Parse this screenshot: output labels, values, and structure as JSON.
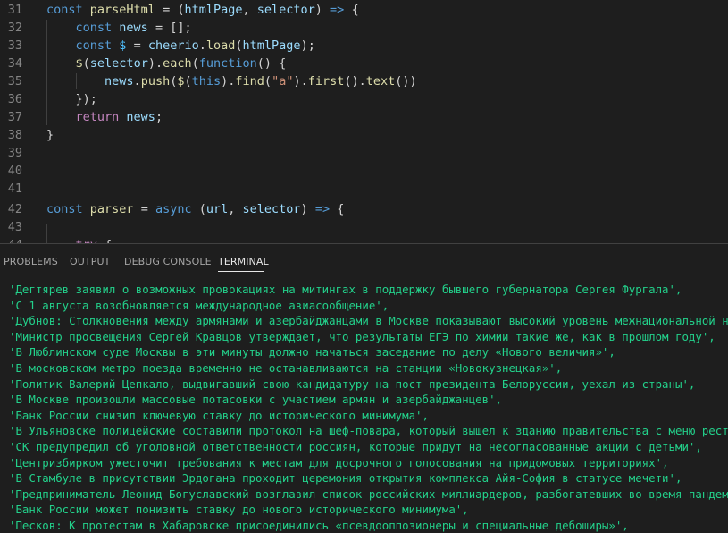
{
  "editor": {
    "lines": [
      {
        "n": "31",
        "tokens": [
          [
            "kw",
            "const "
          ],
          [
            "fn",
            "parseHtml"
          ],
          [
            "pn",
            " = ("
          ],
          [
            "var",
            "htmlPage"
          ],
          [
            "pn",
            ", "
          ],
          [
            "var",
            "selector"
          ],
          [
            "pn",
            ") "
          ],
          [
            "kw",
            "=>"
          ],
          [
            "pn",
            " {"
          ]
        ]
      },
      {
        "n": "32",
        "tokens": [
          [
            "pn",
            "    "
          ],
          [
            "kw",
            "const "
          ],
          [
            "var",
            "news"
          ],
          [
            "pn",
            " = [];"
          ]
        ]
      },
      {
        "n": "33",
        "tokens": [
          [
            "pn",
            "    "
          ],
          [
            "kw",
            "const "
          ],
          [
            "cst",
            "$"
          ],
          [
            "pn",
            " = "
          ],
          [
            "var",
            "cheerio"
          ],
          [
            "pn",
            "."
          ],
          [
            "fn",
            "load"
          ],
          [
            "pn",
            "("
          ],
          [
            "var",
            "htmlPage"
          ],
          [
            "pn",
            ");"
          ]
        ]
      },
      {
        "n": "34",
        "tokens": [
          [
            "pn",
            "    "
          ],
          [
            "fn",
            "$"
          ],
          [
            "pn",
            "("
          ],
          [
            "var",
            "selector"
          ],
          [
            "pn",
            ")."
          ],
          [
            "fn",
            "each"
          ],
          [
            "pn",
            "("
          ],
          [
            "kw",
            "function"
          ],
          [
            "pn",
            "() {"
          ]
        ]
      },
      {
        "n": "35",
        "tokens": [
          [
            "pn",
            "        "
          ],
          [
            "var",
            "news"
          ],
          [
            "pn",
            "."
          ],
          [
            "fn",
            "push"
          ],
          [
            "pn",
            "("
          ],
          [
            "fn",
            "$"
          ],
          [
            "pn",
            "("
          ],
          [
            "kw",
            "this"
          ],
          [
            "pn",
            ")."
          ],
          [
            "fn",
            "find"
          ],
          [
            "pn",
            "("
          ],
          [
            "str",
            "\"a\""
          ],
          [
            "pn",
            ")."
          ],
          [
            "fn",
            "first"
          ],
          [
            "pn",
            "()."
          ],
          [
            "fn",
            "text"
          ],
          [
            "pn",
            "())"
          ]
        ]
      },
      {
        "n": "36",
        "tokens": [
          [
            "pn",
            "    });"
          ]
        ]
      },
      {
        "n": "37",
        "tokens": [
          [
            "pn",
            "    "
          ],
          [
            "kw2",
            "return "
          ],
          [
            "var",
            "news"
          ],
          [
            "pn",
            ";"
          ]
        ]
      },
      {
        "n": "38",
        "tokens": [
          [
            "pn",
            "}"
          ]
        ]
      },
      {
        "n": "39",
        "tokens": []
      },
      {
        "n": "40",
        "tokens": []
      },
      {
        "n": "41",
        "tokens": []
      },
      {
        "n": "42",
        "tokens": [
          [
            "kw",
            "const "
          ],
          [
            "fn",
            "parser"
          ],
          [
            "pn",
            " = "
          ],
          [
            "kw",
            "async"
          ],
          [
            "pn",
            " ("
          ],
          [
            "var",
            "url"
          ],
          [
            "pn",
            ", "
          ],
          [
            "var",
            "selector"
          ],
          [
            "pn",
            ") "
          ],
          [
            "kw",
            "=>"
          ],
          [
            "pn",
            " {"
          ]
        ]
      },
      {
        "n": "43",
        "tokens": []
      },
      {
        "n": "44",
        "tokens": [
          [
            "pn",
            "    "
          ],
          [
            "kw2",
            "try"
          ],
          [
            "pn",
            " {"
          ]
        ]
      }
    ]
  },
  "panel": {
    "tabs": [
      {
        "label": "PROBLEMS",
        "active": false
      },
      {
        "label": "OUTPUT",
        "active": false
      },
      {
        "label": "DEBUG CONSOLE",
        "active": false
      },
      {
        "label": "TERMINAL",
        "active": true
      }
    ]
  },
  "terminal": {
    "lines": [
      "'Дегтярев заявил о возможных провокациях на митингах в поддержку бывшего губернатора Сергея Фургала',",
      "'С 1 августа возобновляется международное авиасообщение',",
      "'Дубнов: Столкновения между армянами и азербайджанцами в Москве показывают высокий уровень межнациональной ненавис",
      "'Министр просвещения Сергей Кравцов утверждает, что результаты ЕГЭ по химии такие же, как в прошлом году',",
      "'В Люблинском суде Москвы в эти минуты должно начаться заседание по делу «Нового величия»',",
      "'В московском метро поезда временно не останавливаются на станции «Новокузнецкая»',",
      "'Политик Валерий Цепкало, выдвигавший свою кандидатуру на пост президента Белоруссии, уехал из страны',",
      "'В Москве произошли массовые потасовки с участием армян и азербайджанцев',",
      "'Банк России снизил ключевую ставку до исторического минимума',",
      "'В Ульяновске полицейские составили протокол на шеф-повара, который вышел к зданию правительства с меню ресторана',",
      "'СК предупредил об уголовной ответственности россиян, которые придут на несогласованные акции с детьми',",
      "'Центризбирком ужесточит требования к местам для досрочного голосования на придомовых территориях',",
      "'В Стамбуле в присутствии Эрдогана проходит церемония открытия комплекса Айя-София в статусе мечети',",
      "'Предприниматель Леонид Богуславский возглавил список российских миллиардеров, разбогатевших во время пандемии',",
      "'Банк России может понизить ставку до нового исторического минимума',",
      "'Песков: К протестам в Хабаровске присоединились «псевдооппозионеры и специальные дебоширы»',"
    ]
  },
  "colors": {
    "background": "#1e1e1e",
    "terminal_text": "#23d18b",
    "line_numbers": "#858585"
  }
}
